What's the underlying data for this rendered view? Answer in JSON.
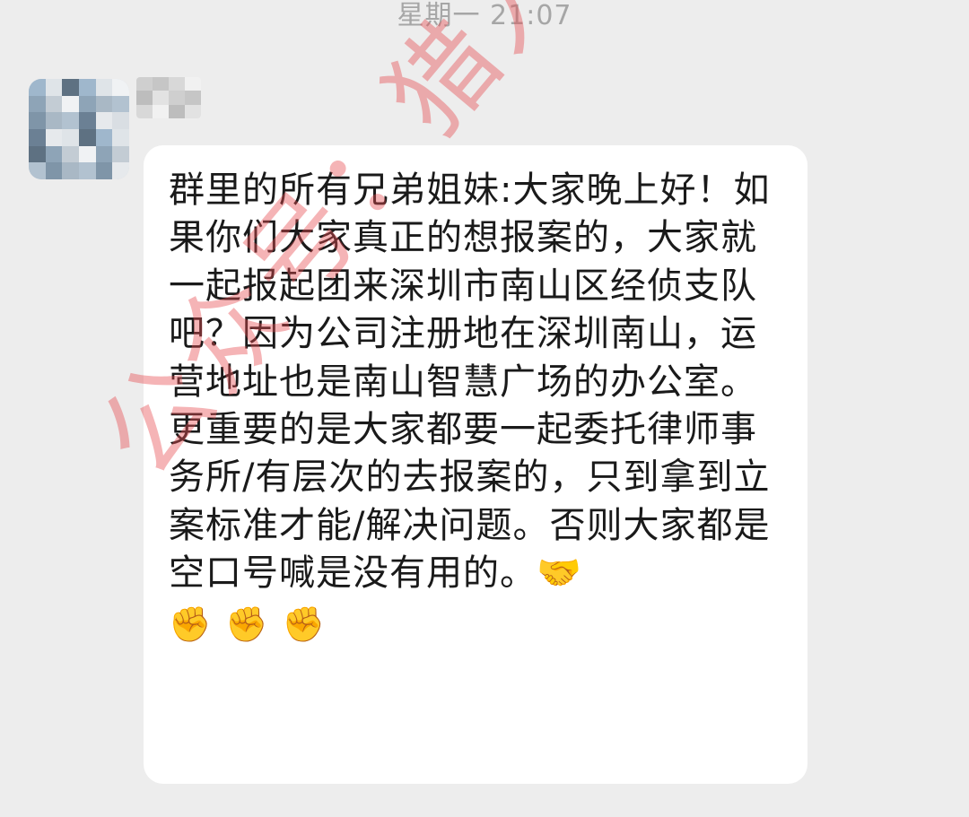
{
  "timestamp": "星期一 21:07",
  "sender": {
    "name": "",
    "avatar_colors": [
      "#9fb7cc",
      "#d9dee3",
      "#7f95a8",
      "#c3ccd4",
      "#5e7182",
      "#e6e9ec",
      "#b2c2d0",
      "#8ea4b7",
      "#dfe4e8",
      "#6b8094",
      "#a9b8c5",
      "#f0f2f4"
    ]
  },
  "message": {
    "text": "群里的所有兄弟姐妹:大家晚上好！如果你们大家真正的想报案的，大家就一起报起团来深圳市南山区经侦支队吧？因为公司注册地在深圳南山，运营地址也是南山智慧广场的办公室。更重要的是大家都要一起委托律师事务所/有层次的去报案的，只到拿到立案标准才能/解决问题。否则大家都是空口号喊是没有用的。",
    "inline_emoji": "🤝",
    "emojis": [
      "✊",
      "✊",
      "✊"
    ]
  },
  "watermark": {
    "text": "公众号：猎人野猫",
    "color": "#e84c52"
  }
}
